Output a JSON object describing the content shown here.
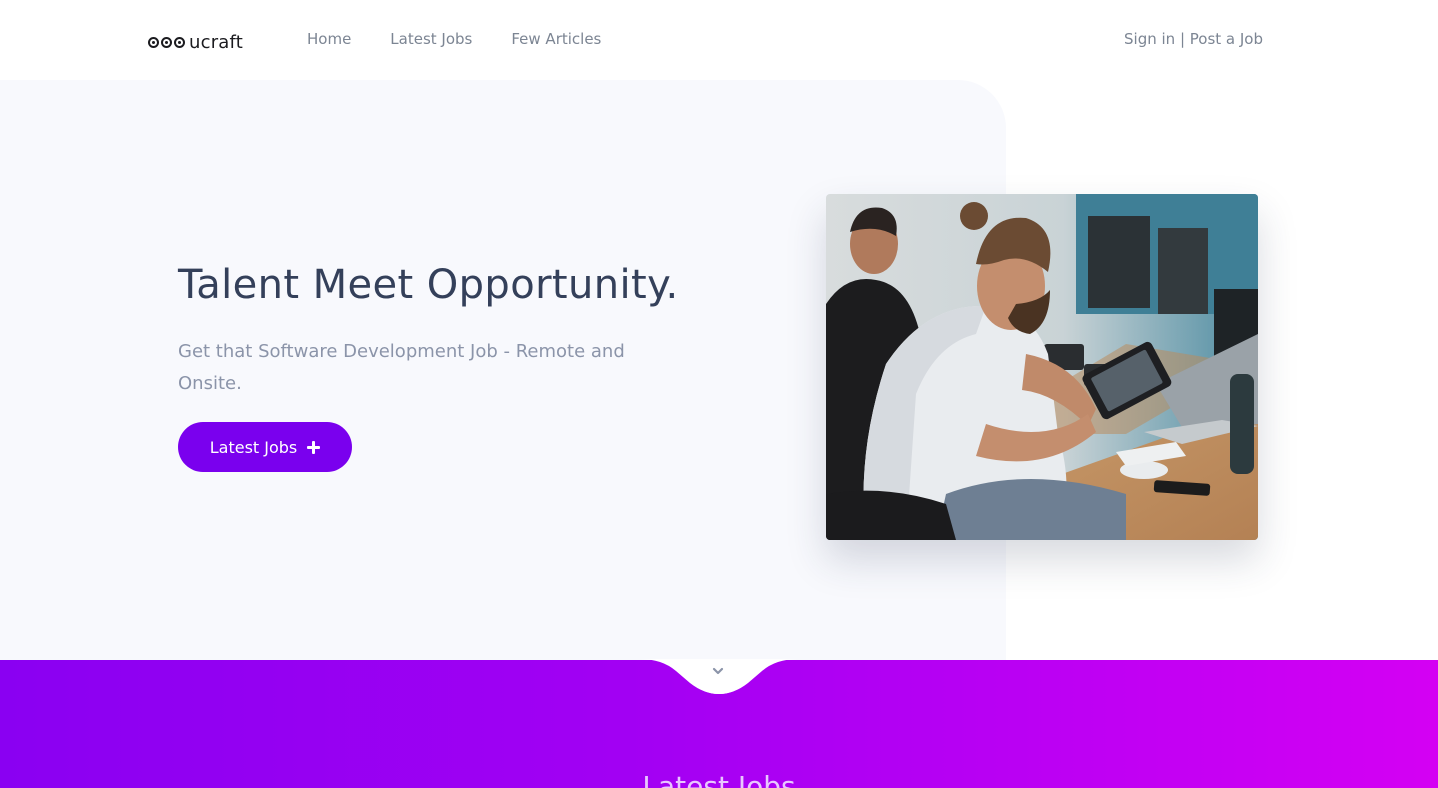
{
  "header": {
    "logo_text": "ucraft",
    "nav": [
      {
        "label": "Home"
      },
      {
        "label": "Latest Jobs"
      },
      {
        "label": "Few Articles"
      }
    ],
    "auth": {
      "sign_in": "Sign in",
      "separator": " | ",
      "post_job": "Post a Job"
    }
  },
  "hero": {
    "title": "Talent Meet Opportunity.",
    "subtitle": "Get that Software Development Job - Remote and Onsite.",
    "button_label": "Latest Jobs",
    "button_icon": "plus-icon",
    "photo_description": ""
  },
  "jobs_section": {
    "heading": "Latest Jobs",
    "scroll_icon": "chevron-down-icon"
  },
  "colors": {
    "accent": "#7a00ee",
    "gradient_start": "#8a00f2",
    "gradient_end": "#d400f3",
    "hero_bg": "#f8f9fd",
    "title": "#34405a",
    "muted_text": "#7c8593"
  }
}
